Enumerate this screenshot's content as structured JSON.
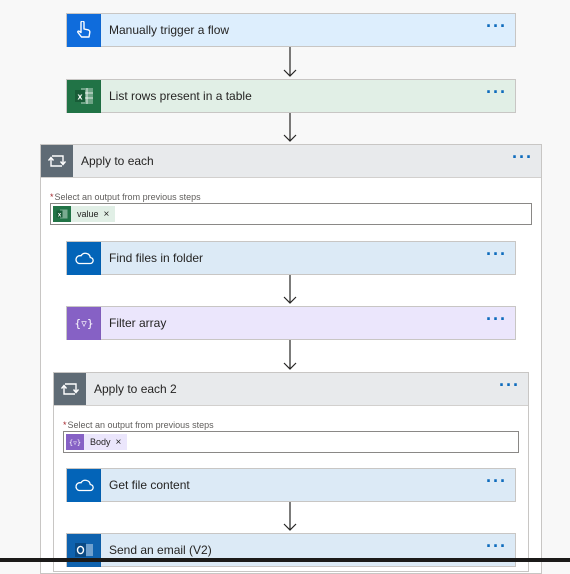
{
  "colors": {
    "trigger_bg": "#ddeefd",
    "trigger_icon": "#0f6cdc",
    "excel_bg": "#e1efe6",
    "excel_icon": "#217346",
    "onedrive_bg": "#dceaf6",
    "onedrive_icon": "#0364b8",
    "filter_bg": "#ebe6fc",
    "filter_icon": "#8661c5",
    "outlook_icon": "#0f62ae",
    "loop_header": "#e8eaec",
    "loop_icon": "#5f6b75"
  },
  "steps": {
    "trigger": {
      "label": "Manually trigger a flow",
      "icon": "hand-pointer-icon"
    },
    "list_rows": {
      "label": "List rows present in a table",
      "icon": "excel-icon"
    },
    "find_files": {
      "label": "Find files in folder",
      "icon": "onedrive-icon"
    },
    "filter_array": {
      "label": "Filter array",
      "icon": "filter-icon"
    },
    "get_file_content": {
      "label": "Get file content",
      "icon": "onedrive-icon"
    },
    "send_email": {
      "label": "Send an email (V2)",
      "icon": "outlook-icon"
    }
  },
  "loops": {
    "outer": {
      "label": "Apply to each",
      "field_label": "Select an output from previous steps",
      "required_mark": "*",
      "token": {
        "label": "value",
        "remove": "×",
        "icon": "excel-icon"
      }
    },
    "inner": {
      "label": "Apply to each 2",
      "field_label": "Select an output from previous steps",
      "required_mark": "*",
      "token": {
        "label": "Body",
        "remove": "×",
        "icon": "filter-icon"
      }
    }
  },
  "more_glyph": "···"
}
